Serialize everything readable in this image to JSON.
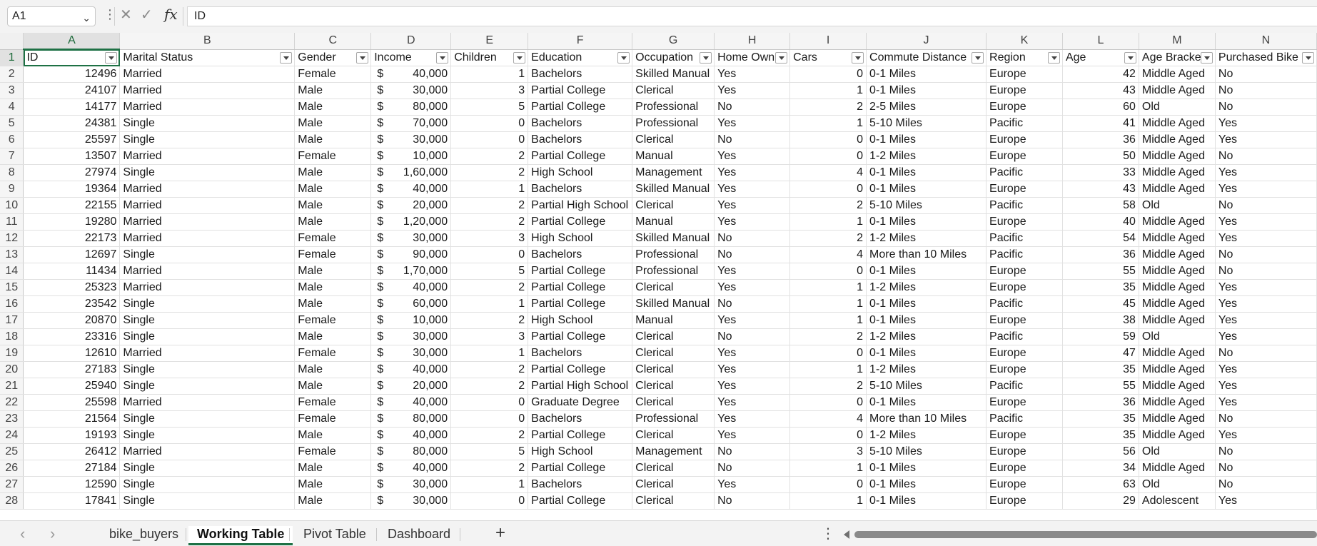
{
  "formula_bar": {
    "cell_ref": "A1",
    "formula": "ID",
    "cancel_icon": "close-icon",
    "enter_icon": "checkmark-icon",
    "fx_label": "fx"
  },
  "columns": [
    "A",
    "B",
    "C",
    "D",
    "E",
    "F",
    "G",
    "H",
    "I",
    "J",
    "K",
    "L",
    "M",
    "N"
  ],
  "headers": [
    "ID",
    "Marital Status",
    "Gender",
    "Income",
    "Children",
    "Education",
    "Occupation",
    "Home Own",
    "Cars",
    "Commute Distance",
    "Region",
    "Age",
    "Age Bracke",
    "Purchased Bike"
  ],
  "currency_symbol": "$",
  "rows": [
    {
      "n": "2",
      "c": [
        "12496",
        "Married",
        "Female",
        "40,000",
        "1",
        "Bachelors",
        "Skilled Manual",
        "Yes",
        "0",
        "0-1 Miles",
        "Europe",
        "42",
        "Middle Aged",
        "No"
      ]
    },
    {
      "n": "3",
      "c": [
        "24107",
        "Married",
        "Male",
        "30,000",
        "3",
        "Partial College",
        "Clerical",
        "Yes",
        "1",
        "0-1 Miles",
        "Europe",
        "43",
        "Middle Aged",
        "No"
      ]
    },
    {
      "n": "4",
      "c": [
        "14177",
        "Married",
        "Male",
        "80,000",
        "5",
        "Partial College",
        "Professional",
        "No",
        "2",
        "2-5 Miles",
        "Europe",
        "60",
        "Old",
        "No"
      ]
    },
    {
      "n": "5",
      "c": [
        "24381",
        "Single",
        "Male",
        "70,000",
        "0",
        "Bachelors",
        "Professional",
        "Yes",
        "1",
        "5-10 Miles",
        "Pacific",
        "41",
        "Middle Aged",
        "Yes"
      ]
    },
    {
      "n": "6",
      "c": [
        "25597",
        "Single",
        "Male",
        "30,000",
        "0",
        "Bachelors",
        "Clerical",
        "No",
        "0",
        "0-1 Miles",
        "Europe",
        "36",
        "Middle Aged",
        "Yes"
      ]
    },
    {
      "n": "7",
      "c": [
        "13507",
        "Married",
        "Female",
        "10,000",
        "2",
        "Partial College",
        "Manual",
        "Yes",
        "0",
        "1-2 Miles",
        "Europe",
        "50",
        "Middle Aged",
        "No"
      ]
    },
    {
      "n": "8",
      "c": [
        "27974",
        "Single",
        "Male",
        "1,60,000",
        "2",
        "High School",
        "Management",
        "Yes",
        "4",
        "0-1 Miles",
        "Pacific",
        "33",
        "Middle Aged",
        "Yes"
      ]
    },
    {
      "n": "9",
      "c": [
        "19364",
        "Married",
        "Male",
        "40,000",
        "1",
        "Bachelors",
        "Skilled Manual",
        "Yes",
        "0",
        "0-1 Miles",
        "Europe",
        "43",
        "Middle Aged",
        "Yes"
      ]
    },
    {
      "n": "10",
      "c": [
        "22155",
        "Married",
        "Male",
        "20,000",
        "2",
        "Partial High School",
        "Clerical",
        "Yes",
        "2",
        "5-10 Miles",
        "Pacific",
        "58",
        "Old",
        "No"
      ]
    },
    {
      "n": "11",
      "c": [
        "19280",
        "Married",
        "Male",
        "1,20,000",
        "2",
        "Partial College",
        "Manual",
        "Yes",
        "1",
        "0-1 Miles",
        "Europe",
        "40",
        "Middle Aged",
        "Yes"
      ]
    },
    {
      "n": "12",
      "c": [
        "22173",
        "Married",
        "Female",
        "30,000",
        "3",
        "High School",
        "Skilled Manual",
        "No",
        "2",
        "1-2 Miles",
        "Pacific",
        "54",
        "Middle Aged",
        "Yes"
      ]
    },
    {
      "n": "13",
      "c": [
        "12697",
        "Single",
        "Female",
        "90,000",
        "0",
        "Bachelors",
        "Professional",
        "No",
        "4",
        "More than 10 Miles",
        "Pacific",
        "36",
        "Middle Aged",
        "No"
      ]
    },
    {
      "n": "14",
      "c": [
        "11434",
        "Married",
        "Male",
        "1,70,000",
        "5",
        "Partial College",
        "Professional",
        "Yes",
        "0",
        "0-1 Miles",
        "Europe",
        "55",
        "Middle Aged",
        "No"
      ]
    },
    {
      "n": "15",
      "c": [
        "25323",
        "Married",
        "Male",
        "40,000",
        "2",
        "Partial College",
        "Clerical",
        "Yes",
        "1",
        "1-2 Miles",
        "Europe",
        "35",
        "Middle Aged",
        "Yes"
      ]
    },
    {
      "n": "16",
      "c": [
        "23542",
        "Single",
        "Male",
        "60,000",
        "1",
        "Partial College",
        "Skilled Manual",
        "No",
        "1",
        "0-1 Miles",
        "Pacific",
        "45",
        "Middle Aged",
        "Yes"
      ]
    },
    {
      "n": "17",
      "c": [
        "20870",
        "Single",
        "Female",
        "10,000",
        "2",
        "High School",
        "Manual",
        "Yes",
        "1",
        "0-1 Miles",
        "Europe",
        "38",
        "Middle Aged",
        "Yes"
      ]
    },
    {
      "n": "18",
      "c": [
        "23316",
        "Single",
        "Male",
        "30,000",
        "3",
        "Partial College",
        "Clerical",
        "No",
        "2",
        "1-2 Miles",
        "Pacific",
        "59",
        "Old",
        "Yes"
      ]
    },
    {
      "n": "19",
      "c": [
        "12610",
        "Married",
        "Female",
        "30,000",
        "1",
        "Bachelors",
        "Clerical",
        "Yes",
        "0",
        "0-1 Miles",
        "Europe",
        "47",
        "Middle Aged",
        "No"
      ]
    },
    {
      "n": "20",
      "c": [
        "27183",
        "Single",
        "Male",
        "40,000",
        "2",
        "Partial College",
        "Clerical",
        "Yes",
        "1",
        "1-2 Miles",
        "Europe",
        "35",
        "Middle Aged",
        "Yes"
      ]
    },
    {
      "n": "21",
      "c": [
        "25940",
        "Single",
        "Male",
        "20,000",
        "2",
        "Partial High School",
        "Clerical",
        "Yes",
        "2",
        "5-10 Miles",
        "Pacific",
        "55",
        "Middle Aged",
        "Yes"
      ]
    },
    {
      "n": "22",
      "c": [
        "25598",
        "Married",
        "Female",
        "40,000",
        "0",
        "Graduate Degree",
        "Clerical",
        "Yes",
        "0",
        "0-1 Miles",
        "Europe",
        "36",
        "Middle Aged",
        "Yes"
      ]
    },
    {
      "n": "23",
      "c": [
        "21564",
        "Single",
        "Female",
        "80,000",
        "0",
        "Bachelors",
        "Professional",
        "Yes",
        "4",
        "More than 10 Miles",
        "Pacific",
        "35",
        "Middle Aged",
        "No"
      ]
    },
    {
      "n": "24",
      "c": [
        "19193",
        "Single",
        "Male",
        "40,000",
        "2",
        "Partial College",
        "Clerical",
        "Yes",
        "0",
        "1-2 Miles",
        "Europe",
        "35",
        "Middle Aged",
        "Yes"
      ]
    },
    {
      "n": "25",
      "c": [
        "26412",
        "Married",
        "Female",
        "80,000",
        "5",
        "High School",
        "Management",
        "No",
        "3",
        "5-10 Miles",
        "Europe",
        "56",
        "Old",
        "No"
      ]
    },
    {
      "n": "26",
      "c": [
        "27184",
        "Single",
        "Male",
        "40,000",
        "2",
        "Partial College",
        "Clerical",
        "No",
        "1",
        "0-1 Miles",
        "Europe",
        "34",
        "Middle Aged",
        "No"
      ]
    },
    {
      "n": "27",
      "c": [
        "12590",
        "Single",
        "Male",
        "30,000",
        "1",
        "Bachelors",
        "Clerical",
        "Yes",
        "0",
        "0-1 Miles",
        "Europe",
        "63",
        "Old",
        "No"
      ]
    },
    {
      "n": "28",
      "c": [
        "17841",
        "Single",
        "Male",
        "30,000",
        "0",
        "Partial College",
        "Clerical",
        "No",
        "1",
        "0-1 Miles",
        "Europe",
        "29",
        "Adolescent",
        "Yes"
      ]
    }
  ],
  "sheet_tabs": {
    "tabs": [
      "bike_buyers",
      "Working Table",
      "Pivot Table",
      "Dashboard"
    ],
    "active": "Working Table",
    "add_label": "+"
  }
}
